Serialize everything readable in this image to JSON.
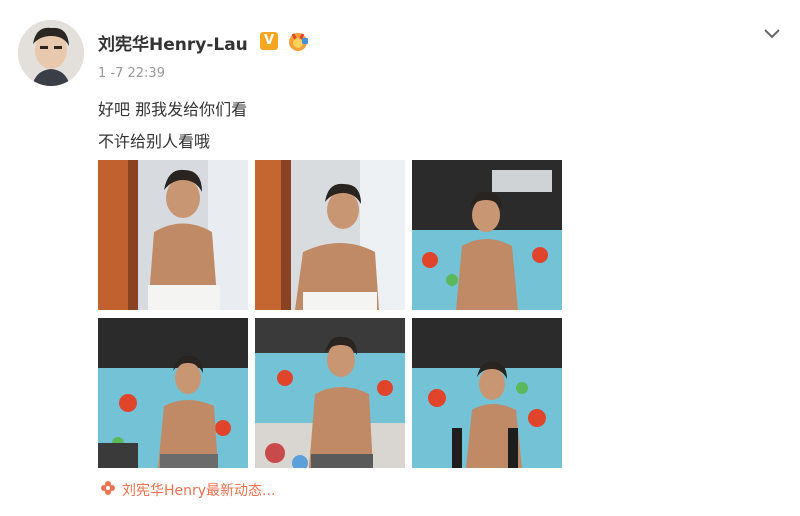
{
  "post": {
    "author": "刘宪华Henry-Lau",
    "verified_badge": "V",
    "timestamp": "1 -7 22:39",
    "text_lines": [
      "好吧 那我发给你们看",
      "不许给别人看哦"
    ],
    "photo_count": 6,
    "photos": [
      {
        "scene": "bathroom-selfie"
      },
      {
        "scene": "bathroom-selfie"
      },
      {
        "scene": "gym"
      },
      {
        "scene": "gym"
      },
      {
        "scene": "gym"
      },
      {
        "scene": "gym"
      }
    ],
    "source_link": "刘宪华Henry最新动态...",
    "icons": {
      "more": "chevron-down-icon",
      "verified": "verified-v-icon",
      "medal": "medal-icon",
      "source": "flower-icon"
    },
    "colors": {
      "accent": "#eb7350",
      "badge": "#f5a623",
      "text": "#333333",
      "muted": "#999999"
    }
  }
}
